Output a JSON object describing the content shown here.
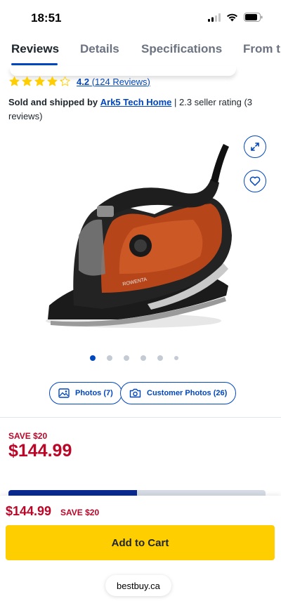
{
  "status": {
    "time": "18:51"
  },
  "tabs": [
    {
      "label": "Reviews"
    },
    {
      "label": "Details"
    },
    {
      "label": "Specifications"
    },
    {
      "label": "From th"
    }
  ],
  "rating": {
    "value": "4.2",
    "count_text": "(124 Reviews)",
    "stars_filled": 4.2,
    "stars_total": 5
  },
  "seller": {
    "prefix": "Sold and shipped by",
    "name": "Ark5 Tech Home",
    "suffix": " | 2.3 seller rating (3 reviews)"
  },
  "product": {
    "brand_mark": "ROWENTA",
    "gallery_count": 6,
    "gallery_active": 0
  },
  "media": {
    "photos_label": "Photos (7)",
    "customer_photos_label": "Customer Photos (26)"
  },
  "price": {
    "save_badge": "SAVE $20",
    "current": "$144.99"
  },
  "sticky": {
    "price": "$144.99",
    "save": "SAVE $20",
    "add_to_cart": "Add to Cart",
    "url": "bestbuy.ca",
    "progress_fraction": 0.5
  },
  "colors": {
    "accent": "#0046be",
    "sale": "#bb0628",
    "cart": "#ffce00",
    "star": "#ffce00"
  },
  "icons": [
    "cellular-signal-icon",
    "wifi-icon",
    "battery-icon",
    "star-icon",
    "expand-icon",
    "heart-icon",
    "image-icon",
    "camera-icon"
  ]
}
